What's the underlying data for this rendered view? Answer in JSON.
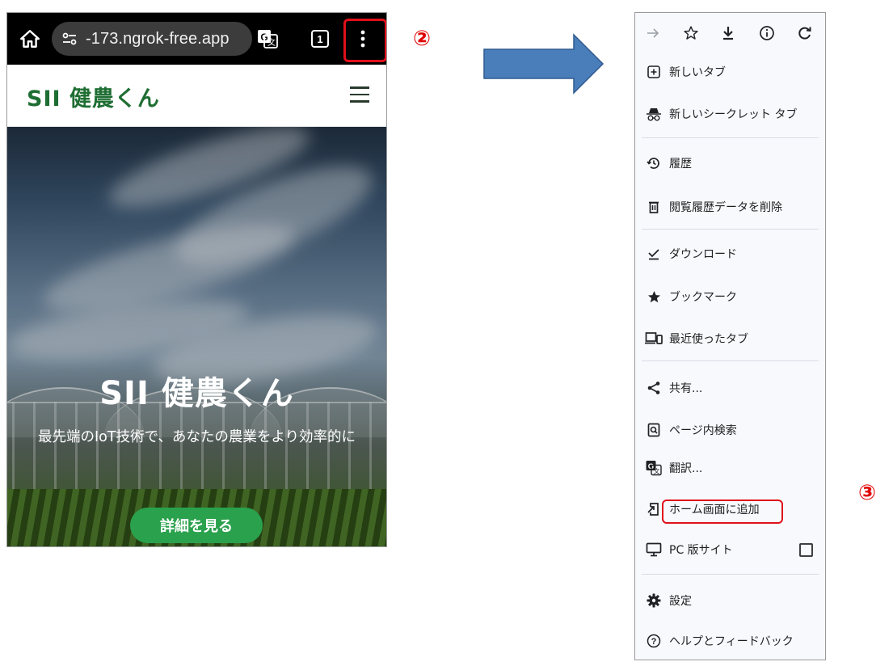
{
  "left_phone": {
    "browser": {
      "url_text": "-173.ngrok-free.app",
      "tab_count": "1"
    },
    "site": {
      "logo_text": "SII 健農くん"
    },
    "hero": {
      "title": "SII 健農くん",
      "subtitle": "最先端のIoT技術で、あなたの農業をより効率的に",
      "button_label": "詳細を見る"
    }
  },
  "steps": {
    "step2": "②",
    "step3": "③"
  },
  "menu": {
    "items": [
      {
        "label": "新しいタブ",
        "icon": "new-tab-icon"
      },
      {
        "label": "新しいシークレット タブ",
        "icon": "incognito-icon"
      },
      {
        "label": "履歴",
        "icon": "history-icon"
      },
      {
        "label": "閲覧履歴データを削除",
        "icon": "trash-icon"
      },
      {
        "label": "ダウンロード",
        "icon": "downloads-icon"
      },
      {
        "label": "ブックマーク",
        "icon": "star-icon"
      },
      {
        "label": "最近使ったタブ",
        "icon": "devices-icon"
      },
      {
        "label": "共有...",
        "icon": "share-icon"
      },
      {
        "label": "ページ内検索",
        "icon": "find-in-page-icon"
      },
      {
        "label": "翻訳...",
        "icon": "translate-icon"
      },
      {
        "label": "ホーム画面に追加",
        "icon": "add-to-home-icon"
      },
      {
        "label": "PC 版サイト",
        "icon": "desktop-icon"
      },
      {
        "label": "設定",
        "icon": "gear-icon"
      },
      {
        "label": "ヘルプとフィードバック",
        "icon": "help-icon"
      }
    ]
  },
  "colors": {
    "highlight": "#e0101a",
    "brand_green": "#1f6e33",
    "button_green": "#2aa14d",
    "arrow_blue": "#4a7ebb",
    "step_red": "#e00000"
  }
}
